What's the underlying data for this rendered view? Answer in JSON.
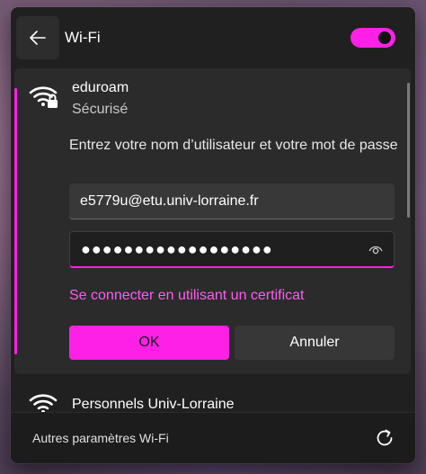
{
  "header": {
    "title": "Wi-Fi",
    "back_icon": "back-arrow-icon",
    "wifi_enabled": true
  },
  "network": {
    "name": "eduroam",
    "status": "Sécurisé",
    "icon": "wifi-lock-icon",
    "prompt": "Entrez votre nom d’utilisateur et votre mot de passe",
    "username_value": "e5779u@etu.univ-lorraine.fr",
    "password_value": "●●●●●●●●●●●●●●●●●●",
    "certificate_link": "Se connecter en utilisant un certificat",
    "ok_label": "OK",
    "cancel_label": "Annuler"
  },
  "next_network": {
    "name": "Personnels Univ-Lorraine",
    "icon": "wifi-icon"
  },
  "footer": {
    "more_settings": "Autres paramètres Wi-Fi",
    "refresh_icon": "refresh-icon"
  },
  "colors": {
    "accent": "#ff20e8",
    "link": "#ff5cf0",
    "panel": "#202020",
    "card": "#2b2b2b"
  }
}
